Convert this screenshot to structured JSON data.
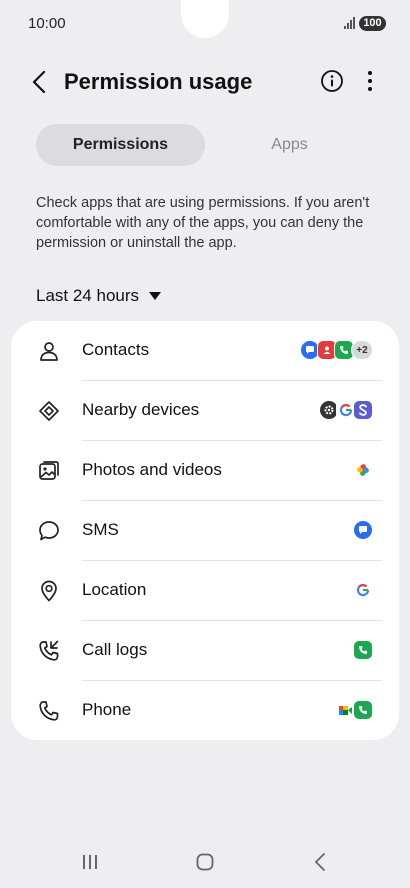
{
  "status_bar": {
    "time": "10:00",
    "battery": "100"
  },
  "header": {
    "title": "Permission usage"
  },
  "tabs": [
    {
      "label": "Permissions",
      "active": true
    },
    {
      "label": "Apps",
      "active": false
    }
  ],
  "description": "Check apps that are using permissions. If you aren't comfortable with any of the apps, you can deny the permission or uninstall the app.",
  "filter": {
    "label": "Last 24 hours"
  },
  "permissions": [
    {
      "label": "Contacts",
      "icon": "person-icon",
      "apps": [
        "messages",
        "contacts",
        "phone"
      ],
      "more": "+2"
    },
    {
      "label": "Nearby devices",
      "icon": "nearby-devices-icon",
      "apps": [
        "settings",
        "google",
        "samsung"
      ]
    },
    {
      "label": "Photos and videos",
      "icon": "photo-icon",
      "apps": [
        "photos"
      ]
    },
    {
      "label": "SMS",
      "icon": "chat-bubble-icon",
      "apps": [
        "messages"
      ]
    },
    {
      "label": "Location",
      "icon": "location-pin-icon",
      "apps": [
        "google"
      ]
    },
    {
      "label": "Call logs",
      "icon": "call-log-icon",
      "apps": [
        "phone"
      ]
    },
    {
      "label": "Phone",
      "icon": "phone-icon",
      "apps": [
        "meet",
        "phone"
      ]
    }
  ],
  "colors": {
    "accent_phone": "#1aa851",
    "accent_messages": "#2a6df4",
    "accent_contacts": "#e23b3b"
  }
}
